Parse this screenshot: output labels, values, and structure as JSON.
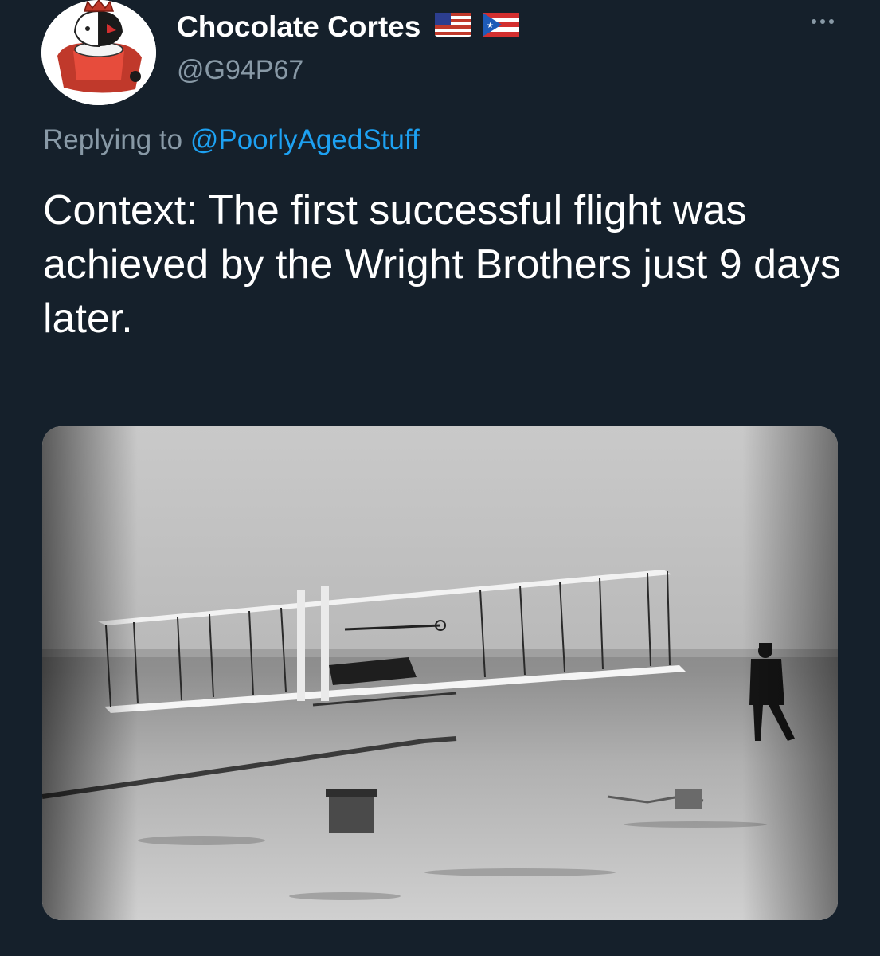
{
  "author": {
    "display_name": "Chocolate Cortes",
    "handle": "@G94P67",
    "flags": [
      "us-flag-emoji",
      "puerto-rico-flag-emoji"
    ]
  },
  "reply": {
    "prefix": "Replying to",
    "mention": "@PoorlyAgedStuff"
  },
  "tweet": {
    "text": "Context: The first successful flight was achieved by the Wright Brothers just 9 days later."
  },
  "media": {
    "type": "photo",
    "description_icon": "wright-flyer-photo"
  },
  "colors": {
    "background": "#15202b",
    "secondary_text": "#8899a6",
    "accent": "#1da1f2"
  }
}
